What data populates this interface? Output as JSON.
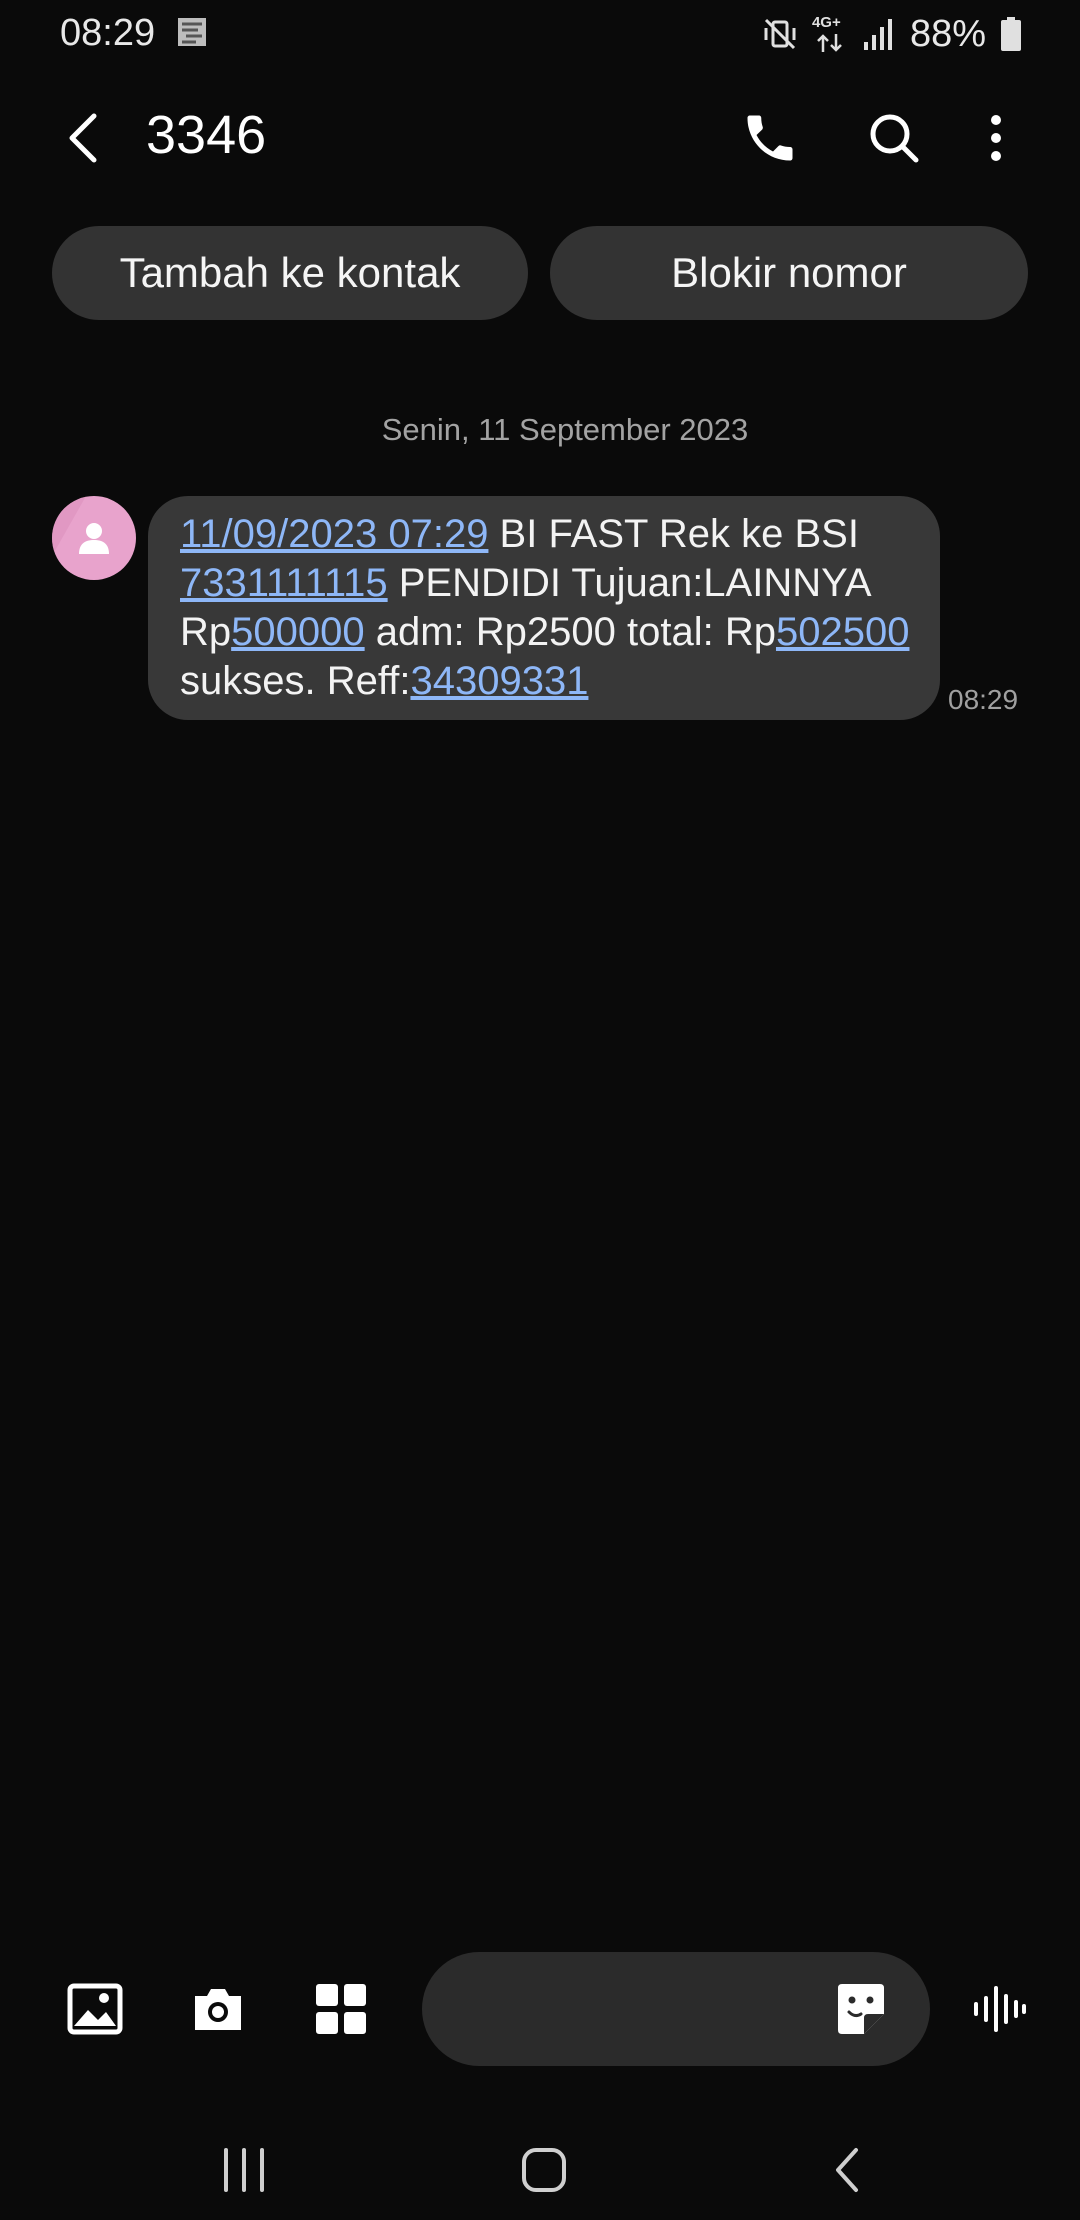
{
  "status_bar": {
    "time": "08:29",
    "battery_percent": "88%",
    "network": "4G+",
    "icons": [
      "notification-icon",
      "vibrate-mute-icon",
      "data-arrows-icon",
      "signal-icon",
      "battery-icon"
    ]
  },
  "header": {
    "title": "3346",
    "icons": [
      "back-arrow-icon",
      "phone-icon",
      "search-icon",
      "more-vert-icon"
    ]
  },
  "actions": {
    "add_contact": "Tambah ke kontak",
    "block_number": "Blokir nomor"
  },
  "conversation": {
    "date": "Senin, 11 September 2023",
    "message": {
      "parts": [
        {
          "text": "11/09/2023 07:29",
          "link": true
        },
        {
          "text": " BI FAST Rek ke BSI ",
          "link": false
        },
        {
          "text": "7331111115",
          "link": true
        },
        {
          "text": " PENDIDI Tujuan:LAINNYA Rp",
          "link": false
        },
        {
          "text": "500000",
          "link": true
        },
        {
          "text": " adm: Rp2500 total: Rp",
          "link": false
        },
        {
          "text": "502500",
          "link": true
        },
        {
          "text": " sukses. Reff:",
          "link": false
        },
        {
          "text": "34309331",
          "link": true
        }
      ],
      "time": "08:29"
    }
  },
  "composer": {
    "icons": [
      "gallery-icon",
      "camera-icon",
      "apps-icon",
      "sticker-icon",
      "voice-icon"
    ]
  },
  "navigation": {
    "icons": [
      "recents-icon",
      "home-icon",
      "nav-back-icon"
    ]
  },
  "colors": {
    "background": "#0a0a0a",
    "bubble": "#383838",
    "link": "#8eb7f7",
    "chip": "#333333",
    "avatar": "#e8a3cc"
  }
}
